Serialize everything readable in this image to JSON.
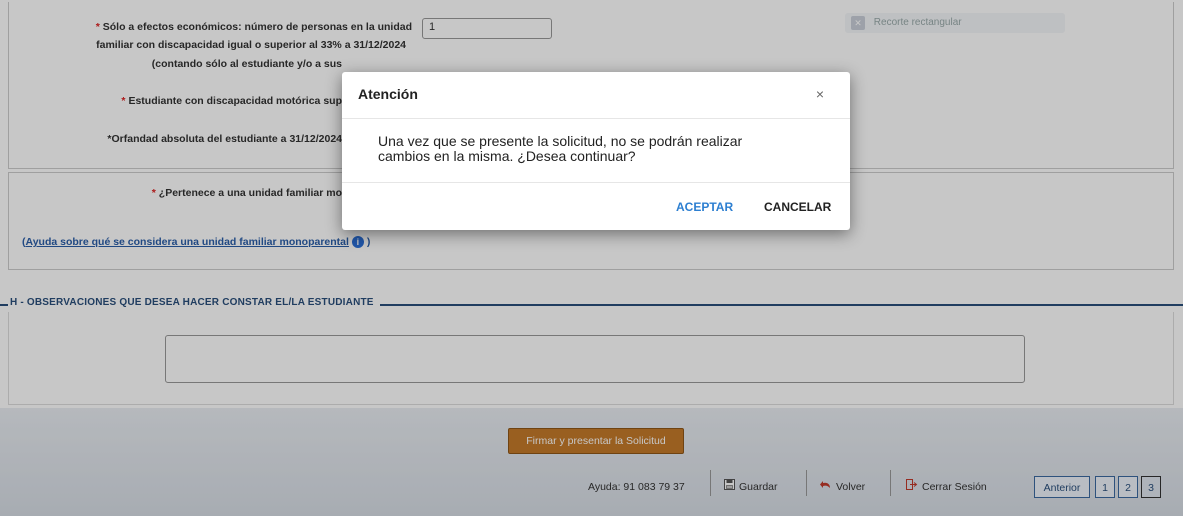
{
  "form": {
    "row1_line1": "Sólo a efectos económicos: número de personas en la unidad",
    "row1_line2": "familiar con discapacidad igual o superior al 33% a 31/12/2024",
    "row1_line3": "(contando sólo al estudiante y/o a sus",
    "row1_value": "1",
    "row2_label": "Estudiante con discapacidad motórica sup",
    "row3_label": "*Orfandad absoluta del estudiante a 31/12/2024",
    "row4_label": "¿Pertenece a una unidad familiar mo",
    "required_marker": "*",
    "help_open": "(",
    "help_link": "Ayuda sobre qué se considera una unidad familiar monoparental",
    "help_close": ")",
    "info_glyph": "i",
    "recorte_label": "Recorte rectangular",
    "recorte_glyph": "✕"
  },
  "section_h": {
    "title": "H - OBSERVACIONES QUE DESEA HACER CONSTAR EL/LA ESTUDIANTE"
  },
  "footer": {
    "sign_button": "Firmar y presentar la Solicitud",
    "help_phone": "Ayuda: 91 083 79 37",
    "guardar": "Guardar",
    "volver": "Volver",
    "cerrar_sesion": "Cerrar Sesión",
    "anterior": "Anterior",
    "pages": [
      "1",
      "2",
      "3"
    ]
  },
  "modal": {
    "title": "Atención",
    "close": "×",
    "message_line1": "Una vez que se presente la solicitud, no se podrán realizar",
    "message_line2": "cambios en la misma. ¿Desea continuar?",
    "accept": "ACEPTAR",
    "cancel": "CANCELAR"
  },
  "colors": {
    "accent": "#2d7fd1",
    "section_header": "#2a4f7c",
    "sign_button": "#c47a2a",
    "required": "#dd2222"
  },
  "icons": [
    "save-icon",
    "back-arrow-icon",
    "logout-icon",
    "info-icon",
    "close-icon"
  ]
}
